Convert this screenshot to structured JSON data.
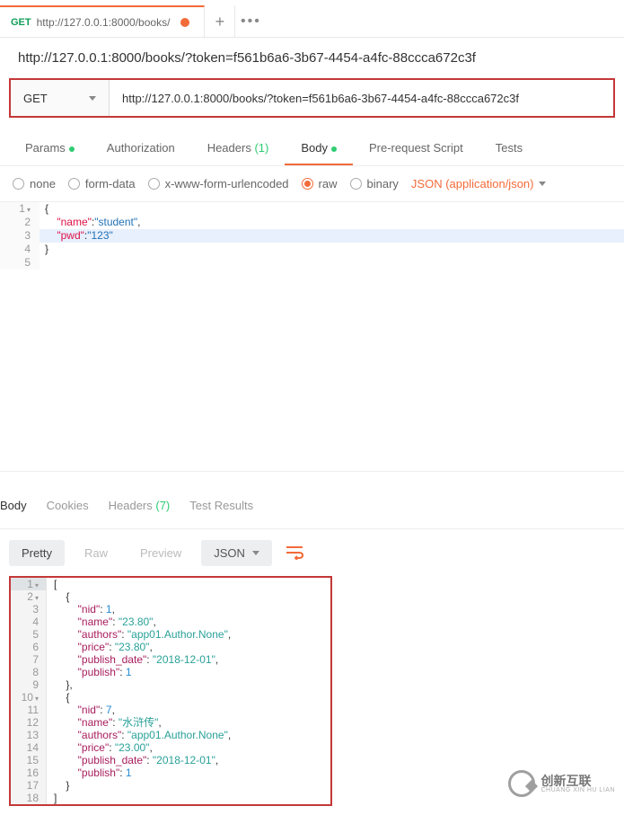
{
  "tab": {
    "method": "GET",
    "title": "http://127.0.0.1:8000/books/"
  },
  "url_title": "http://127.0.0.1:8000/books/?token=f561b6a6-3b67-4454-a4fc-88ccca672c3f",
  "method": "GET",
  "url": "http://127.0.0.1:8000/books/?token=f561b6a6-3b67-4454-a4fc-88ccca672c3f",
  "req_tabs": {
    "params": "Params",
    "auth": "Authorization",
    "headers": "Headers",
    "headers_count": "(1)",
    "body": "Body",
    "pre": "Pre-request Script",
    "tests": "Tests"
  },
  "body_types": {
    "none": "none",
    "form": "form-data",
    "xform": "x-www-form-urlencoded",
    "raw": "raw",
    "binary": "binary",
    "content": "JSON (application/json)"
  },
  "editor": {
    "l1": "{",
    "l2_k": "\"name\"",
    "l2_v": "\"student\"",
    "l3_k": "\"pwd\"",
    "l3_v": "\"123\"",
    "l4": "}",
    "l5": ""
  },
  "resp_tabs": {
    "body": "Body",
    "cookies": "Cookies",
    "headers": "Headers",
    "headers_count": "(7)",
    "tests": "Test Results"
  },
  "resp_toolbar": {
    "pretty": "Pretty",
    "raw": "Raw",
    "preview": "Preview",
    "json": "JSON"
  },
  "chart_data": {
    "type": "table",
    "data": [
      {
        "nid": 1,
        "name": "23.80",
        "authors": "app01.Author.None",
        "price": "23.80",
        "publish_date": "2018-12-01",
        "publish": 1
      },
      {
        "nid": 7,
        "name": "水浒传",
        "authors": "app01.Author.None",
        "price": "23.00",
        "publish_date": "2018-12-01",
        "publish": 1
      }
    ]
  },
  "resp": {
    "r1": "[",
    "r2": "    {",
    "r3a": "\"nid\"",
    "r3b": "1",
    "r4a": "\"name\"",
    "r4b": "\"23.80\"",
    "r5a": "\"authors\"",
    "r5b": "\"app01.Author.None\"",
    "r6a": "\"price\"",
    "r6b": "\"23.80\"",
    "r7a": "\"publish_date\"",
    "r7b": "\"2018-12-01\"",
    "r8a": "\"publish\"",
    "r8b": "1",
    "r9": "    },",
    "r10": "    {",
    "r11a": "\"nid\"",
    "r11b": "7",
    "r12a": "\"name\"",
    "r12b": "\"水浒传\"",
    "r13a": "\"authors\"",
    "r13b": "\"app01.Author.None\"",
    "r14a": "\"price\"",
    "r14b": "\"23.00\"",
    "r15a": "\"publish_date\"",
    "r15b": "\"2018-12-01\"",
    "r16a": "\"publish\"",
    "r16b": "1",
    "r17": "    }",
    "r18": "]"
  },
  "wm": {
    "cn": "创新互联",
    "en": "CHUANG XIN HU LIAN"
  }
}
